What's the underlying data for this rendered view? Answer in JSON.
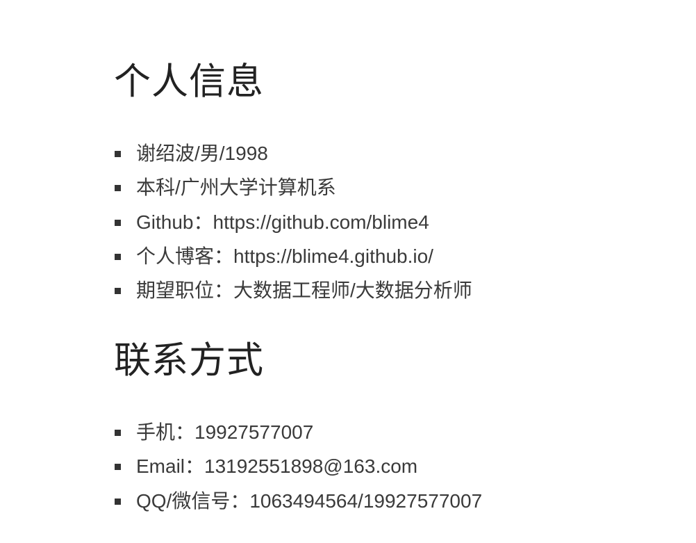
{
  "sections": {
    "info": {
      "title": "个人信息",
      "items": [
        "谢绍波/男/1998",
        "本科/广州大学计算机系",
        "Github：https://github.com/blime4",
        "个人博客：https://blime4.github.io/",
        "期望职位：大数据工程师/大数据分析师"
      ]
    },
    "contact": {
      "title": "联系方式",
      "items": [
        "手机：19927577007",
        "Email：13192551898@163.com",
        "QQ/微信号：1063494564/19927577007"
      ]
    }
  }
}
